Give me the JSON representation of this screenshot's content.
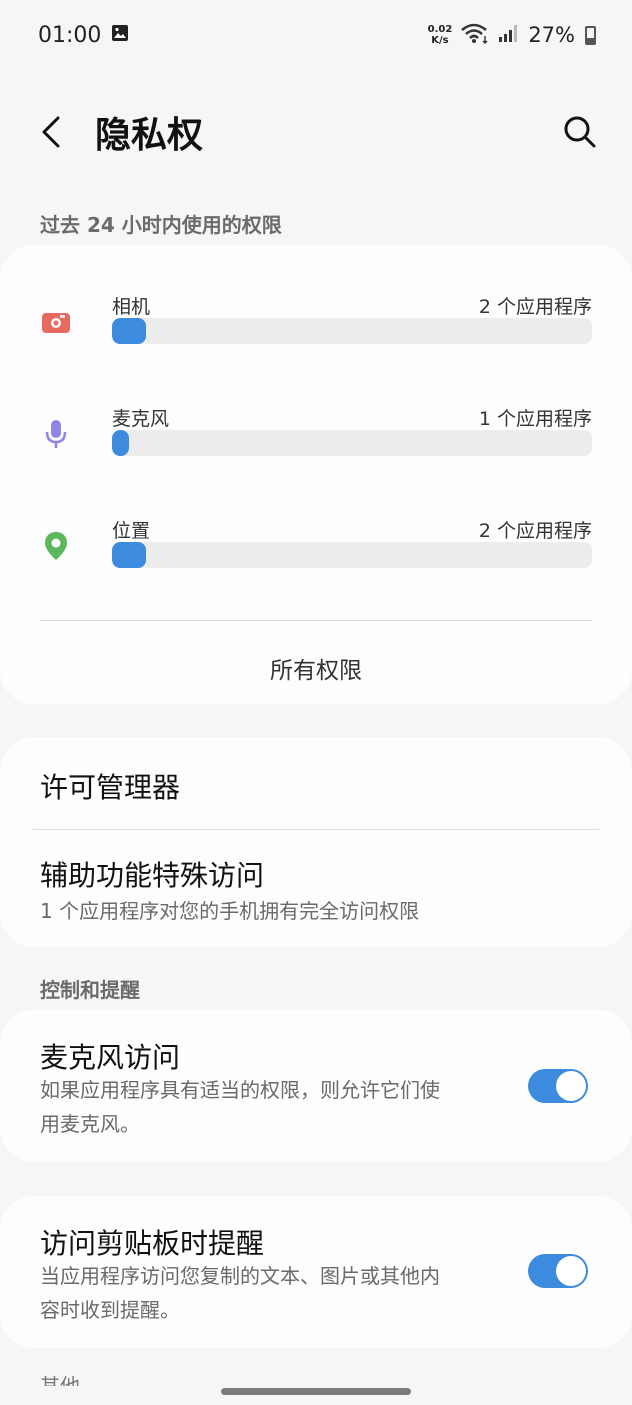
{
  "status_bar": {
    "time": "01:00",
    "net_speed_value": "0.02",
    "net_speed_unit": "K/s",
    "battery": "27%"
  },
  "header": {
    "title": "隐私权"
  },
  "usage_section": {
    "label": "过去 24 小时内使用的权限",
    "permissions": [
      {
        "name": "相机",
        "count": "2 个应用程序",
        "fraction": 0.07,
        "icon": "camera-icon",
        "color": "#e8695f"
      },
      {
        "name": "麦克风",
        "count": "1 个应用程序",
        "fraction": 0.035,
        "icon": "microphone-icon",
        "color": "#8f85e6"
      },
      {
        "name": "位置",
        "count": "2 个应用程序",
        "fraction": 0.07,
        "icon": "location-pin-icon",
        "color": "#5cb85c"
      }
    ],
    "all_permissions": "所有权限"
  },
  "manager_card": {
    "permission_manager": "许可管理器",
    "accessibility_title": "辅助功能特殊访问",
    "accessibility_sub": "1 个应用程序对您的手机拥有完全访问权限"
  },
  "controls_section": {
    "label": "控制和提醒",
    "mic_access": {
      "title": "麦克风访问",
      "sub_line1": "如果应用程序具有适当的权限，则允许它们使",
      "sub_line2": "用麦克风。",
      "enabled": true
    },
    "clipboard_alert": {
      "title": "访问剪贴板时提醒",
      "sub_line1": "当应用程序访问您复制的文本、图片或其他内",
      "sub_line2": "容时收到提醒。",
      "enabled": true
    },
    "partial_next_label": "其他"
  },
  "colors": {
    "accent": "#3d8bdf",
    "background": "#f6f6f6",
    "card": "#fdfdfd"
  }
}
